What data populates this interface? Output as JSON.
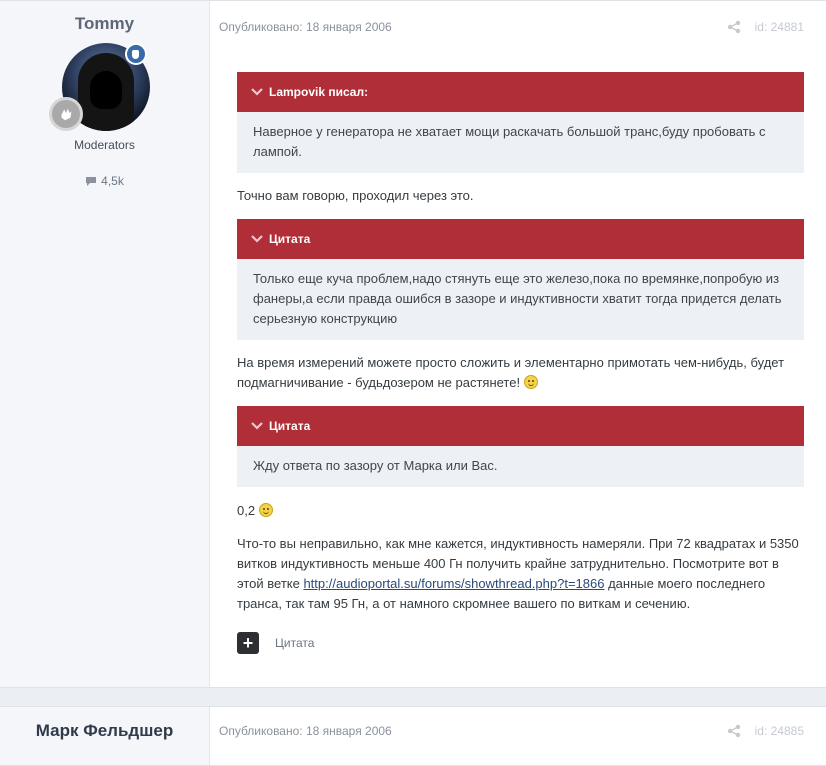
{
  "post1": {
    "author": {
      "name": "Tommy",
      "group": "Moderators",
      "post_count": "4,5k"
    },
    "published": "Опубликовано: 18 января 2006",
    "post_id": "id: 24881",
    "quote1": {
      "header": "Lampovik писал:",
      "body": "Наверное у генератора не хватает мощи раскачать большой транс,буду пробовать с лампой."
    },
    "para1": "Точно вам говорю, проходил через это.",
    "quote2": {
      "header": "Цитата",
      "body": "Только еще куча проблем,надо стянуть еще это железо,пока по времянке,попробую из фанеры,а если правда ошибся в зазоре и индуктивности хватит тогда придется делать серьезную конструкцию"
    },
    "para2": "На время измерений можете просто сложить и элементарно примотать чем-нибудь, будет подмагничивание - будьдозером не растянете!",
    "quote3": {
      "header": "Цитата",
      "body": "Жду ответа по зазору от Марка или Вас."
    },
    "para3": "0,2",
    "para4_start": "Что-то вы неправильно, как мне кажется, индуктивность намеряли. При 72 квадратах и 5350 витков индуктивность меньше 400 Гн получить крайне затруднительно. Посмотрите вот в этой ветке ",
    "para4_link": "http://audioportal.su/forums/showthread.php?t=1866",
    "para4_end": " данные моего последнего транса, так там 95 Гн, а от намного скромнее вашего по виткам и сечению.",
    "actions": {
      "plus_label": "+",
      "quote_label": "Цитата"
    }
  },
  "post2": {
    "author": {
      "name": "Марк Фельдшер"
    },
    "published": "Опубликовано: 18 января 2006",
    "post_id": "id: 24885"
  },
  "colors": {
    "quote_header": "#b02e38",
    "quote_body": "#edf0f4",
    "author_panel": "#f4f6f9",
    "moderator_badge": "#3a6ba9"
  },
  "icons": {
    "share": "share-icon",
    "comment": "comment-icon",
    "chevron": "chevron-down-icon",
    "shield": "shield-icon",
    "rank": "hand-icon"
  }
}
